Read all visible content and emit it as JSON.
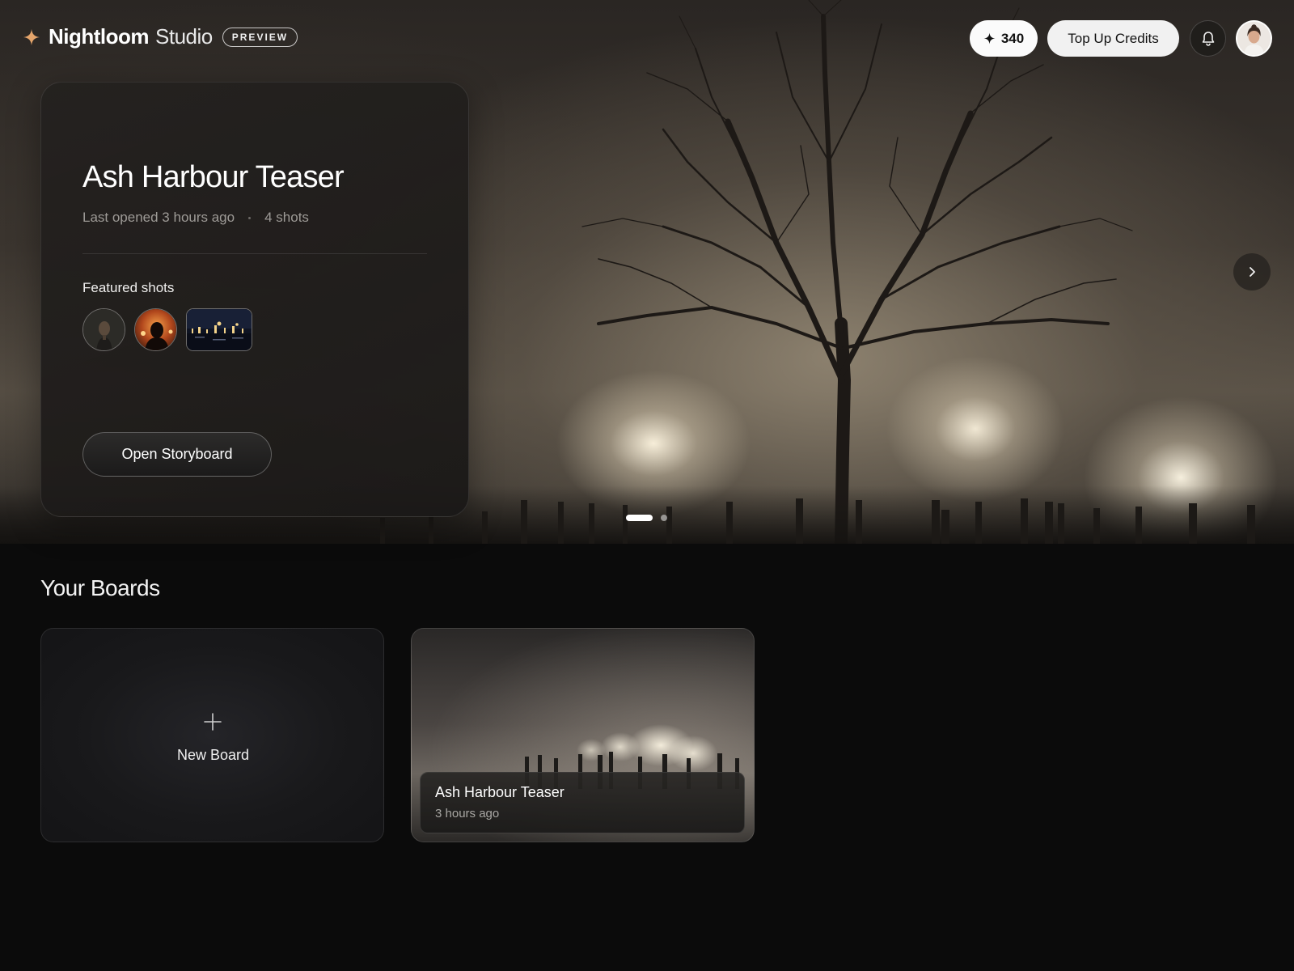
{
  "app": {
    "brand_name": "Nightloom",
    "brand_sub": "Studio",
    "badge": "PREVIEW"
  },
  "header": {
    "credits": "340",
    "topup_label": "Top Up Credits",
    "icons": [
      "sparkle-icon",
      "bell-icon",
      "avatar"
    ]
  },
  "hero": {
    "title": "Ash Harbour Teaser",
    "last_opened": "Last opened 3 hours ago",
    "shots": "4 shots",
    "featured_label": "Featured shots",
    "open_label": "Open Storyboard",
    "carousel_pages": 2,
    "carousel_active": 1
  },
  "boards": {
    "title": "Your Boards",
    "new_label": "New Board",
    "items": [
      {
        "name": "Ash Harbour Teaser",
        "time": "3 hours ago"
      }
    ]
  },
  "colors": {
    "accent_star": "#e5a56b",
    "background": "#0b0b0b"
  }
}
